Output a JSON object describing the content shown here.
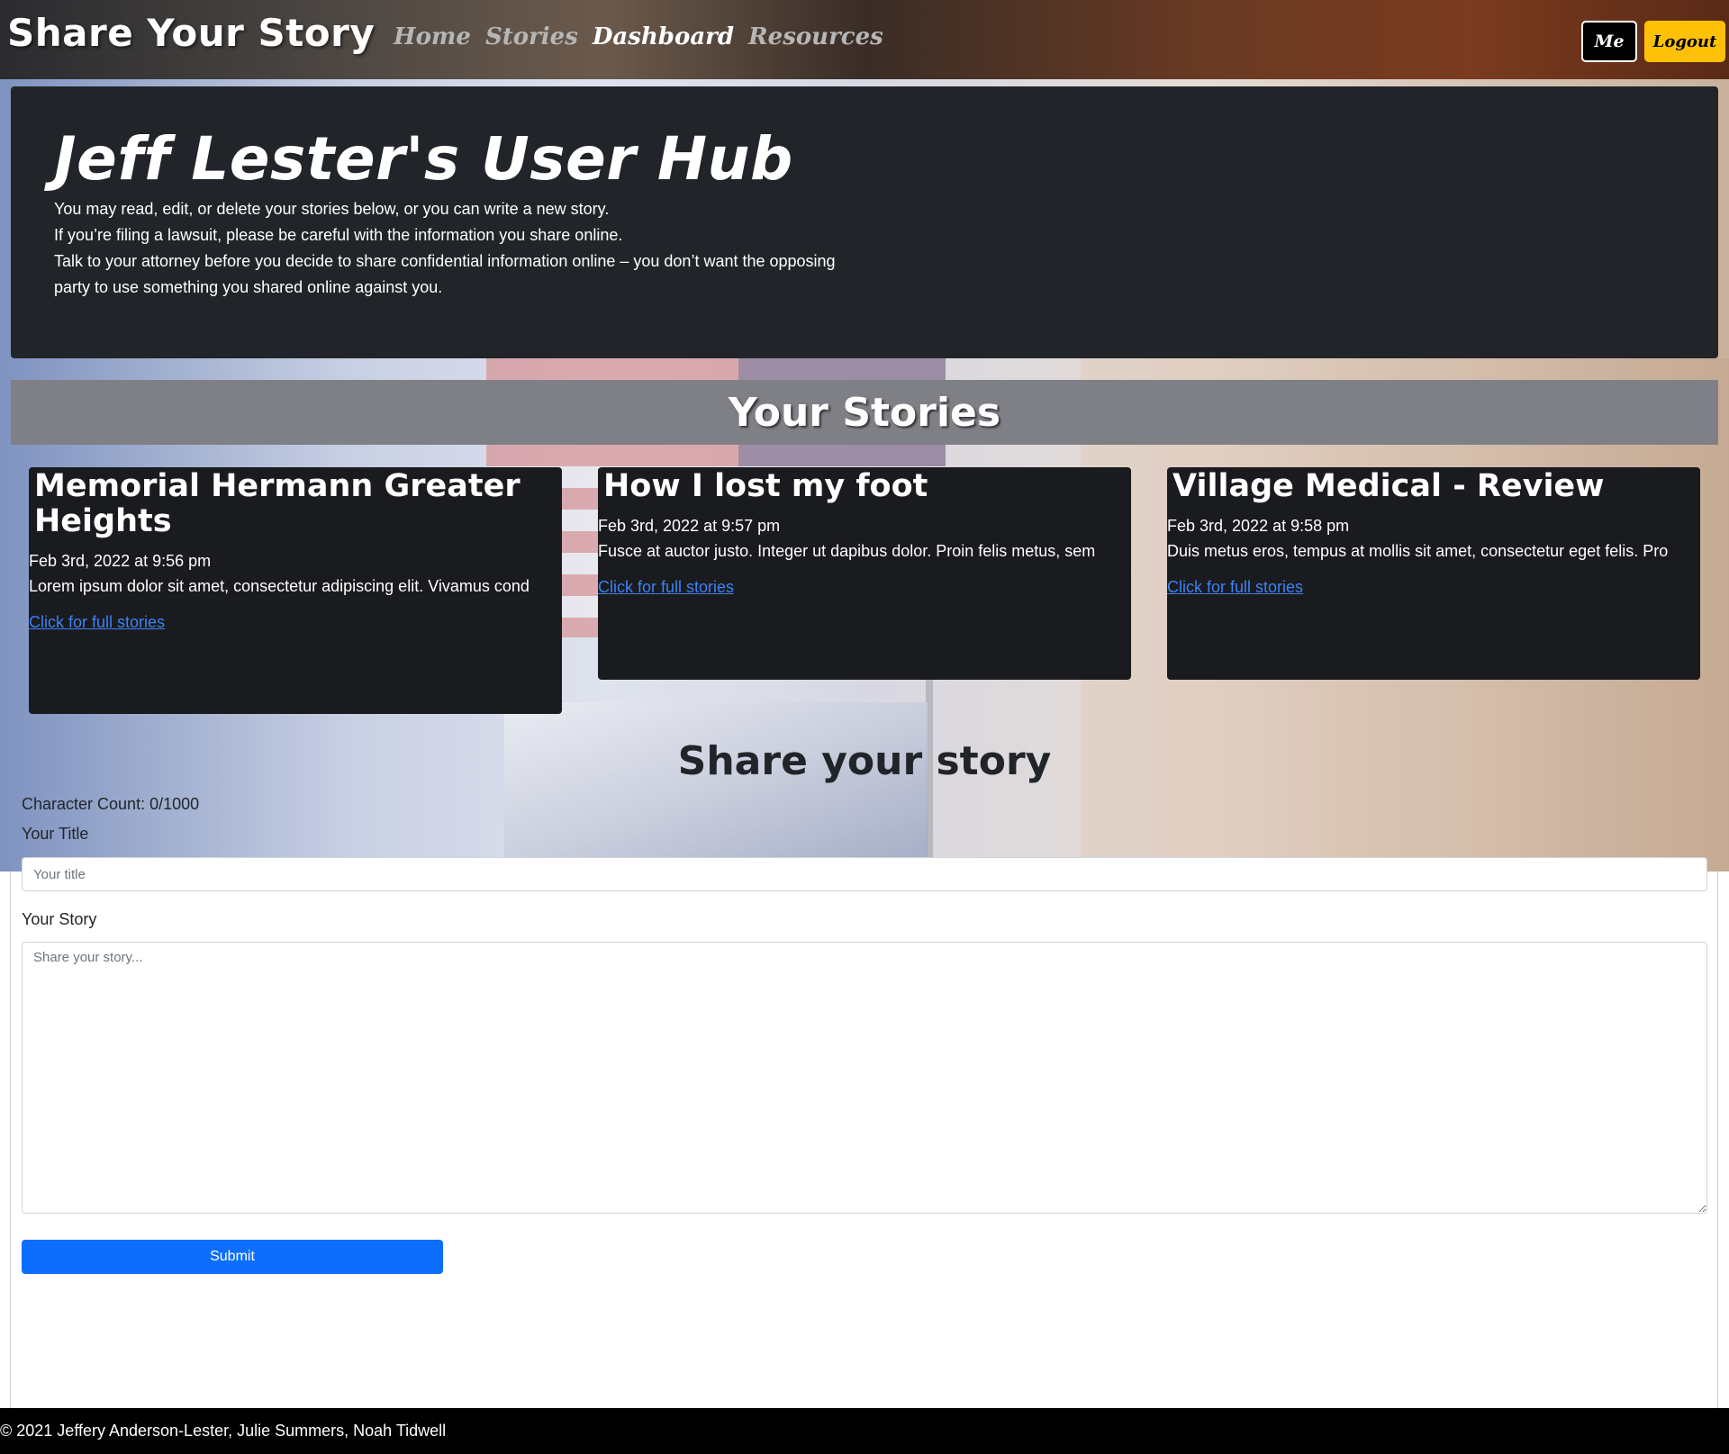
{
  "navbar": {
    "brand": "Share Your Story",
    "links": [
      "Home",
      "Stories",
      "Dashboard",
      "Resources"
    ],
    "active_link": "Dashboard",
    "me_label": "Me",
    "logout_label": "Logout"
  },
  "hub": {
    "title": "Jeff Lester's User Hub",
    "lines": [
      "You may read, edit, or delete your stories below, or you can write a new story.",
      "If you’re filing a lawsuit, please be careful with the information you share online.",
      "Talk to your attorney before you decide to share confidential information online – you don’t want the opposing party to use something you shared online against you."
    ]
  },
  "stories_section": {
    "title": "Your Stories"
  },
  "stories": [
    {
      "title": "Memorial Hermann Greater Heights",
      "date": "Feb 3rd, 2022 at 9:56 pm",
      "excerpt": "Lorem ipsum dolor sit amet, consectetur adipiscing elit. Vivamus cond",
      "link": "Click for full stories"
    },
    {
      "title": "How I lost my foot",
      "date": "Feb 3rd, 2022 at 9:57 pm",
      "excerpt": "Fusce at auctor justo. Integer ut dapibus dolor. Proin felis metus, sem",
      "link": "Click for full stories"
    },
    {
      "title": "Village Medical - Review",
      "date": "Feb 3rd, 2022 at 9:58 pm",
      "excerpt": "Duis metus eros, tempus at mollis sit amet, consectetur eget felis. Pro",
      "link": "Click for full stories"
    }
  ],
  "form": {
    "title": "Share your story",
    "char_count": "Character Count: 0/1000",
    "title_label": "Your Title",
    "title_placeholder": "Your title",
    "story_label": "Your Story",
    "story_placeholder": "Share your story...",
    "submit_label": "Submit"
  },
  "footer": {
    "text": "© 2021 Jeffery Anderson-Lester, Julie Summers, Noah Tidwell"
  },
  "colors": {
    "dark_panel": "#212529",
    "card_bg": "#1a1b1e",
    "stories_bar": "#7f8086",
    "logout_yellow": "#ffc107",
    "submit_blue": "#0d6efd",
    "link_blue": "#3b82f6"
  }
}
